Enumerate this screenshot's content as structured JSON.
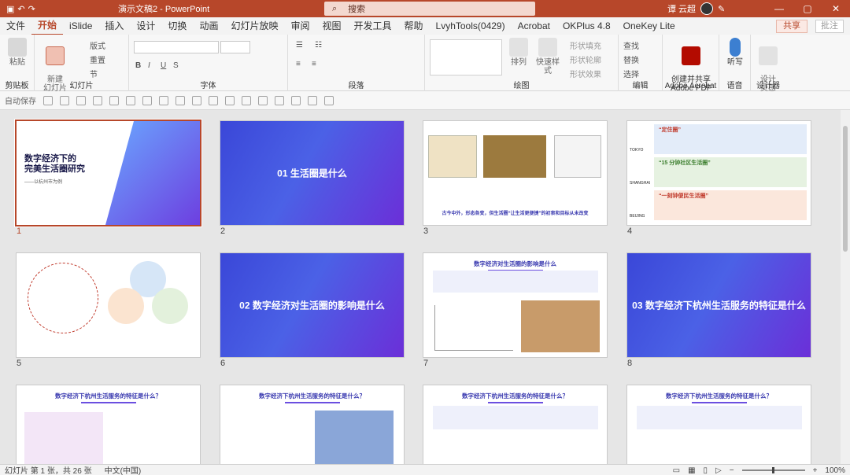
{
  "titlebar": {
    "doc_title": "演示文稿2  -  PowerPoint",
    "search_placeholder": "搜索",
    "user": "谭 云超",
    "min": "—",
    "restore": "▢",
    "close": "✕"
  },
  "tabs": [
    "文件",
    "开始",
    "iSlide",
    "插入",
    "设计",
    "切换",
    "动画",
    "幻灯片放映",
    "审阅",
    "视图",
    "开发工具",
    "帮助",
    "LvyhTools(0429)",
    "Acrobat",
    "OKPlus 4.8",
    "OneKey Lite"
  ],
  "active_tab": "开始",
  "share_label": "共享",
  "comment_label": "批注",
  "ribbon": {
    "paste": "粘贴",
    "clipboard": "剪贴板",
    "new_slide": "新建\n幻灯片",
    "layout": "版式",
    "reset": "重置",
    "section": "节",
    "slides_group": "幻灯片",
    "font_group": "字体",
    "paragraph_group": "段落",
    "arrange": "排列",
    "quick_styles": "快速样式",
    "shape_fill": "形状填充",
    "shape_outline": "形状轮廓",
    "shape_effects": "形状效果",
    "drawing_group": "绘图",
    "find": "查找",
    "replace": "替换",
    "select": "选择",
    "editing_group": "编辑",
    "create_pdf": "创建并共享\nAdobe PDF",
    "adobe_group": "Adobe Acrobat",
    "dictate": "听写",
    "voice_group": "语音",
    "designer": "设计\n灵感",
    "designer_group": "设计器"
  },
  "qat_autosave": "自动保存",
  "slides": [
    {
      "num": "1",
      "title": "数字经济下的\n完美生活圈研究",
      "sub": "——以杭州市为例"
    },
    {
      "num": "2",
      "title": "01 生活圈是什么"
    },
    {
      "num": "3",
      "caption": "古今中外，形态各变，但生活圈“让生活更便捷”的初衷和目标从未改变"
    },
    {
      "num": "4",
      "items": [
        "“定住圈”",
        "“15 分钟社区生活圈”",
        "“一刻钟便民生活圈”"
      ],
      "cities": [
        "TOKYO",
        "SHANGHAI",
        "BEIJING"
      ]
    },
    {
      "num": "5"
    },
    {
      "num": "6",
      "title": "02 数字经济对生活圈的影响是什么"
    },
    {
      "num": "7",
      "title": "数字经济对生活圈的影响是什么"
    },
    {
      "num": "8",
      "title": "03 数字经济下杭州生活服务的特征是什么"
    },
    {
      "num": "9",
      "title": "数字经济下杭州生活服务的特征是什么？"
    },
    {
      "num": "10",
      "title": "数字经济下杭州生活服务的特征是什么？"
    },
    {
      "num": "11",
      "title": "数字经济下杭州生活服务的特征是什么？"
    },
    {
      "num": "12",
      "title": "数字经济下杭州生活服务的特征是什么？"
    }
  ],
  "status": {
    "slide_info": "幻灯片 第 1 张，共 26 张",
    "language": "中文(中国)",
    "zoom": "100%"
  },
  "colors": {
    "accent": "#b7472a",
    "gradient_start": "#3a47d8",
    "gradient_end": "#6b2fd8"
  }
}
